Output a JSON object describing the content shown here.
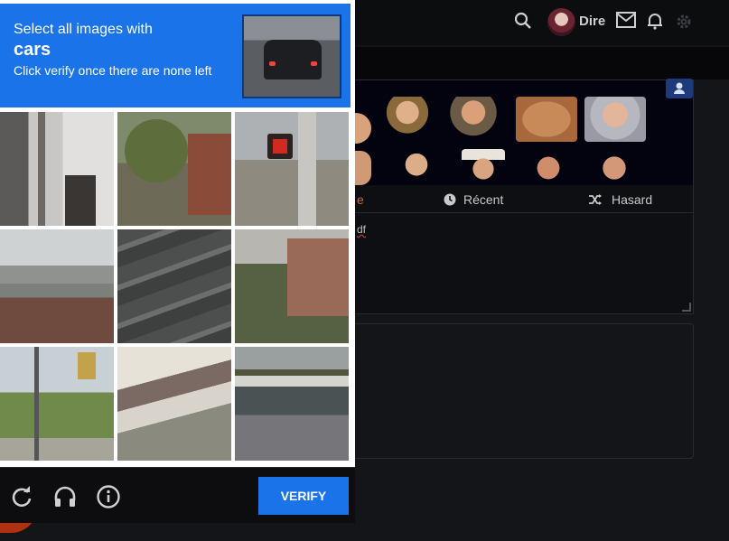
{
  "forum": {
    "username": "Dire",
    "tabs": [
      "e",
      "Récent",
      "Hasard"
    ],
    "draft_text": "df"
  },
  "captcha": {
    "instruction_line1": "Select all images with",
    "keyword": "cars",
    "instruction_line2": "Click verify once there are none left",
    "verify_label": "VERIFY",
    "tiles": [
      {
        "scene": "white-house-corner"
      },
      {
        "scene": "trees-brick-building"
      },
      {
        "scene": "pedestrian-signal-pole"
      },
      {
        "scene": "rooftops-houses"
      },
      {
        "scene": "road-curb-closeup"
      },
      {
        "scene": "brick-house-trees"
      },
      {
        "scene": "traffic-light-trees"
      },
      {
        "scene": "overpass-bridge"
      },
      {
        "scene": "highway-guardrail"
      }
    ],
    "footer_icons": [
      "refresh-icon",
      "headphones-icon",
      "info-icon"
    ]
  },
  "colors": {
    "captcha_blue": "#1a73e8",
    "page_dark": "#141518"
  }
}
